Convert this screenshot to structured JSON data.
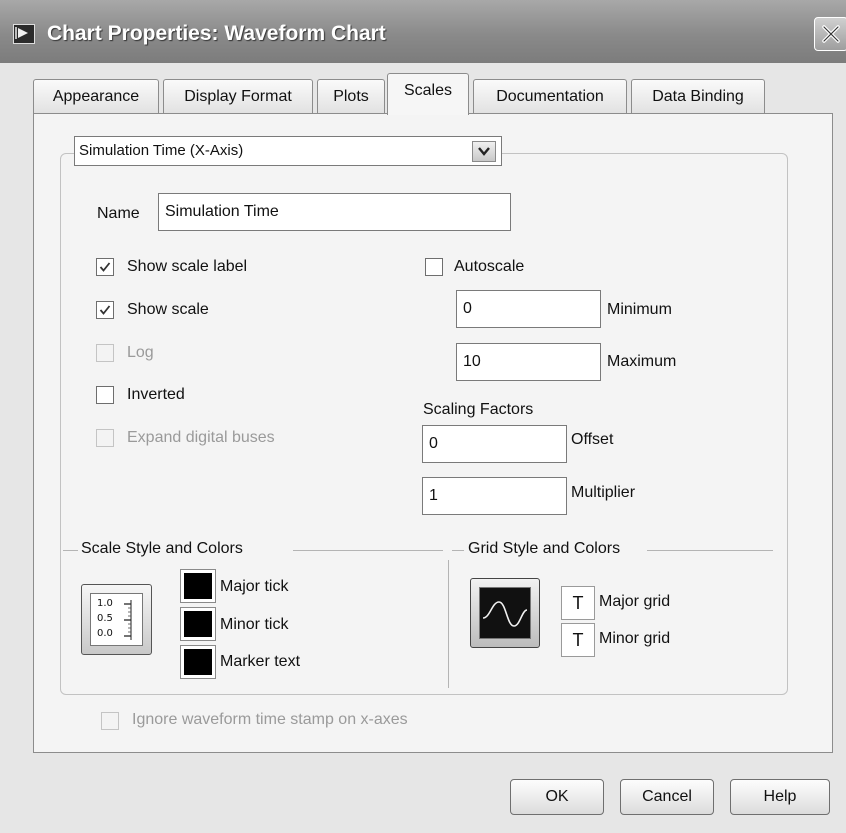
{
  "window": {
    "title": "Chart Properties: Waveform Chart"
  },
  "tabs": [
    {
      "label": "Appearance"
    },
    {
      "label": "Display Format"
    },
    {
      "label": "Plots"
    },
    {
      "label": "Scales",
      "active": true
    },
    {
      "label": "Documentation"
    },
    {
      "label": "Data Binding"
    }
  ],
  "scales": {
    "axis_select": {
      "value": "Simulation Time (X-Axis)"
    },
    "name": {
      "label": "Name",
      "value": "Simulation Time"
    },
    "checkboxes": {
      "show_scale_label": {
        "label": "Show scale label",
        "checked": true,
        "enabled": true
      },
      "show_scale": {
        "label": "Show scale",
        "checked": true,
        "enabled": true
      },
      "log": {
        "label": "Log",
        "checked": false,
        "enabled": false
      },
      "inverted": {
        "label": "Inverted",
        "checked": false,
        "enabled": true
      },
      "expand_digital_buses": {
        "label": "Expand digital buses",
        "checked": false,
        "enabled": false
      },
      "autoscale": {
        "label": "Autoscale",
        "checked": false,
        "enabled": true
      }
    },
    "minimum": {
      "label": "Minimum",
      "value": "0"
    },
    "maximum": {
      "label": "Maximum",
      "value": "10"
    },
    "scaling_factors": {
      "heading": "Scaling Factors",
      "offset": {
        "label": "Offset",
        "value": "0"
      },
      "multiplier": {
        "label": "Multiplier",
        "value": "1"
      }
    },
    "scale_style": {
      "heading": "Scale Style and Colors",
      "preview_ticks": [
        "1.0",
        "0.5",
        "0.0"
      ],
      "colors": [
        {
          "label": "Major tick",
          "color": "#000000"
        },
        {
          "label": "Minor tick",
          "color": "#000000"
        },
        {
          "label": "Marker text",
          "color": "#000000"
        }
      ]
    },
    "grid_style": {
      "heading": "Grid Style and Colors",
      "colors": [
        {
          "label": "Major grid",
          "glyph": "T"
        },
        {
          "label": "Minor grid",
          "glyph": "T"
        }
      ]
    },
    "ignore_timestamp": {
      "label": "Ignore waveform time stamp on x-axes",
      "checked": false,
      "enabled": false
    }
  },
  "buttons": {
    "ok": "OK",
    "cancel": "Cancel",
    "help": "Help"
  },
  "colors": {
    "titlebar": "#8a8a8a",
    "panel": "#f4f4f4",
    "window": "#e6e6e6"
  }
}
